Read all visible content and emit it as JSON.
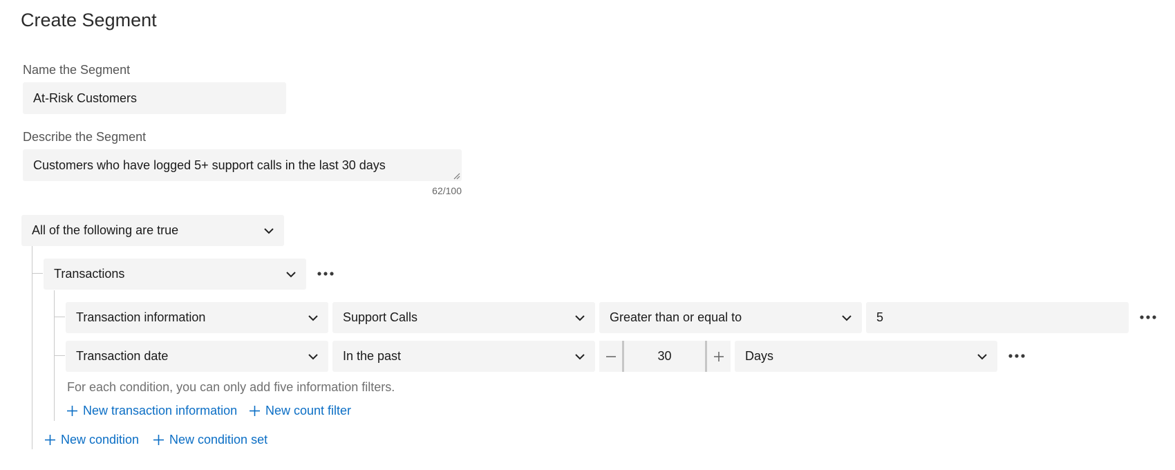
{
  "page": {
    "title": "Create Segment"
  },
  "name_field": {
    "label": "Name the Segment",
    "value": "At-Risk Customers"
  },
  "description_field": {
    "label": "Describe the Segment",
    "value": "Customers who have logged 5+ support calls in the last 30 days",
    "counter": "62/100"
  },
  "condition_set": {
    "logic": "All of the following are true",
    "condition": {
      "type": "Transactions",
      "filters": [
        {
          "field": "Transaction information",
          "attribute": "Support Calls",
          "operator": "Greater than or equal to",
          "value": "5"
        },
        {
          "field": "Transaction date",
          "operator": "In the past",
          "amount": "30",
          "unit": "Days"
        }
      ],
      "hint": "For each condition, you can only add five information filters.",
      "new_transaction_information": "New transaction information",
      "new_count_filter": "New count filter"
    },
    "new_condition": "New condition",
    "new_condition_set": "New condition set"
  },
  "icons": {
    "chevron": "chevron-down-icon",
    "more": "more-horizontal-icon",
    "plus": "plus-icon",
    "minus": "minus-icon",
    "grip": "resize-grip-icon"
  },
  "colors": {
    "link": "#0b6ec5",
    "field_bg": "#f4f4f4",
    "tree_line": "#c9c9c9"
  }
}
